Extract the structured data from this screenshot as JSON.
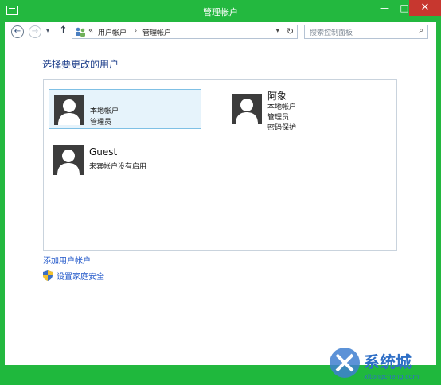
{
  "window": {
    "title": "管理帐户",
    "min_glyph": "—",
    "max_glyph": "□",
    "close_glyph": "✕"
  },
  "nav": {
    "back_glyph": "←",
    "forward_glyph": "→",
    "dropdown_glyph": "▾",
    "up_glyph": "↑",
    "address": {
      "chevron": "«",
      "crumbs": [
        "用户帐户",
        "管理帐户"
      ],
      "sep": "›",
      "dropdown_glyph": "▾"
    },
    "refresh_glyph": "↻",
    "search_placeholder": "搜索控制面板",
    "search_glyph": "⌕"
  },
  "main": {
    "heading": "选择要更改的用户",
    "accounts": [
      {
        "name": "",
        "lines": [
          "本地帐户",
          "管理员"
        ],
        "selected": true
      },
      {
        "name": "阿象",
        "lines": [
          "本地帐户",
          "管理员",
          "密码保护"
        ],
        "selected": false
      },
      {
        "name": "Guest",
        "lines": [
          "来宾帐户没有启用"
        ],
        "selected": false
      }
    ],
    "links": {
      "add_user": "添加用户帐户",
      "family_safety": "设置家庭安全"
    }
  },
  "watermark": {
    "text": "系统城",
    "url": "xitongcheng.com"
  },
  "colors": {
    "frame": "#23b83f",
    "close": "#c7372f",
    "heading": "#1e3f8b",
    "link": "#1f56c9",
    "selection": "#e6f3fb"
  }
}
